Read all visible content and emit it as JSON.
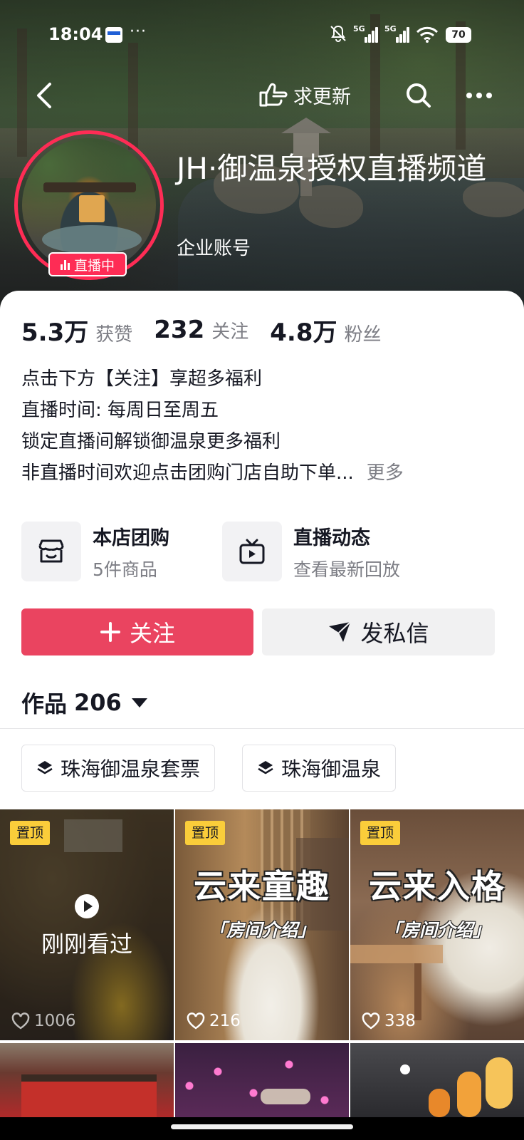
{
  "status_bar": {
    "time": "18:04",
    "battery": "70",
    "signal1_label": "5G",
    "signal2_label": "5G"
  },
  "nav": {
    "update_label": "求更新"
  },
  "profile": {
    "name": "JH·御温泉授权直播频道",
    "account_type": "企业账号",
    "live_badge": "直播中"
  },
  "stats": [
    {
      "value": "5.3万",
      "label": "获赞"
    },
    {
      "value": "232",
      "label": "关注"
    },
    {
      "value": "4.8万",
      "label": "粉丝"
    }
  ],
  "bio": {
    "lines": [
      "点击下方【关注】享超多福利",
      "直播时间: 每周日至周五",
      "锁定直播间解锁御温泉更多福利",
      "非直播时间欢迎点击团购门店自助下单..."
    ],
    "more_label": "更多"
  },
  "features": [
    {
      "title": "本店团购",
      "subtitle": "5件商品",
      "icon": "shop-icon"
    },
    {
      "title": "直播动态",
      "subtitle": "查看最新回放",
      "icon": "tv-icon"
    }
  ],
  "actions": {
    "follow_label": "关注",
    "message_label": "发私信"
  },
  "works": {
    "tab_label": "作品",
    "count": "206"
  },
  "collections": [
    {
      "label": "珠海御温泉套票",
      "icon": "layers-icon"
    },
    {
      "label": "珠海御温泉",
      "icon": "layers-icon"
    }
  ],
  "videos": [
    {
      "pinned": "置顶",
      "likes": "1006",
      "overlay": "刚刚看过"
    },
    {
      "pinned": "置顶",
      "likes": "216",
      "caption": "云来童趣",
      "subcaption": "「房间介绍」"
    },
    {
      "pinned": "置顶",
      "likes": "338",
      "caption": "云来入格",
      "subcaption": "「房间介绍」"
    }
  ],
  "colors": {
    "accent": "#ea4460",
    "live_pink": "#fe2c55",
    "pin_yellow": "#facd3a",
    "muted_text": "#7d7e85"
  }
}
